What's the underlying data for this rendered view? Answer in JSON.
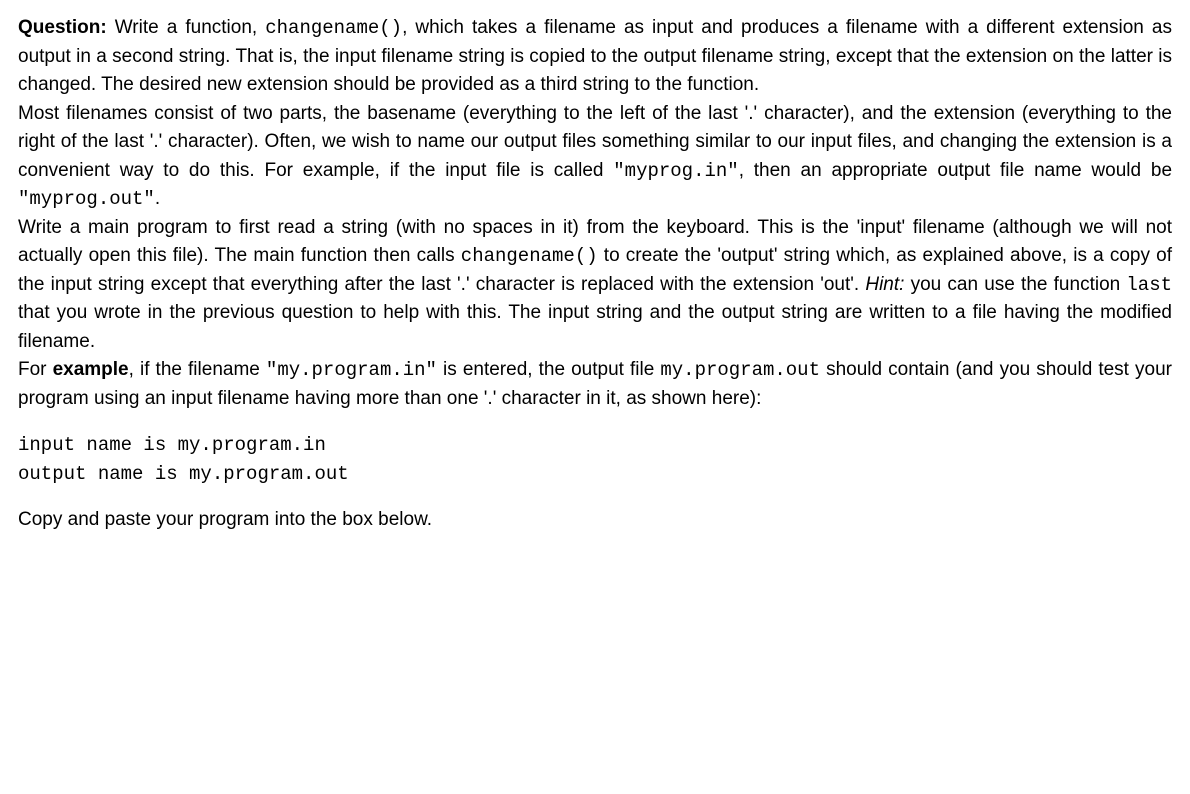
{
  "question_label": "Question:",
  "p1_a": " Write a function, ",
  "p1_code1": "changename()",
  "p1_b": ", which takes a filename as input and produces a filename with a different extension as output in a second string. That is, the input filename string is copied to the output filename string, except that the extension on the latter is changed. The desired new extension should be provided as a third string to the function.",
  "p2_a": "Most filenames consist of two parts, the basename (everything to the left of the last '.' character), and the extension (everything to the right of the last '.' character). Often, we wish to name our output files something similar to our input files, and changing the extension is a convenient way to do this. For example, if the input file is called ",
  "p2_code1": "\"myprog.in\"",
  "p2_b": ", then an appropriate output file name would be ",
  "p2_code2": "\"myprog.out\"",
  "p2_c": ".",
  "p3_a": "Write a main program to first read a string (with no spaces in it) from the keyboard. This is the 'input' filename (although we will not actually open this file). The main function then calls ",
  "p3_code1": "changename()",
  "p3_b": " to create the 'output' string which, as explained above, is a copy of the input string except that everything after the last '.' character is replaced with the extension 'out'. ",
  "p3_hint": "Hint:",
  "p3_c": " you can use the function ",
  "p3_code2": "last",
  "p3_d": " that you wrote in the previous question to help with this. The input string and the output string are written to a file having the modified filename.",
  "p4_a": "For ",
  "p4_bold": "example",
  "p4_b": ", if the filename ",
  "p4_code1": "\"my.program.in\"",
  "p4_c": " is entered, the output file ",
  "p4_code2": "my.program.out",
  "p4_d": " should contain (and you should test your program using an input filename having more than one '.' character in it, as shown here):",
  "example_lines": "input name is my.program.in\noutput name is my.program.out",
  "p5": "Copy and paste your program into the box below."
}
